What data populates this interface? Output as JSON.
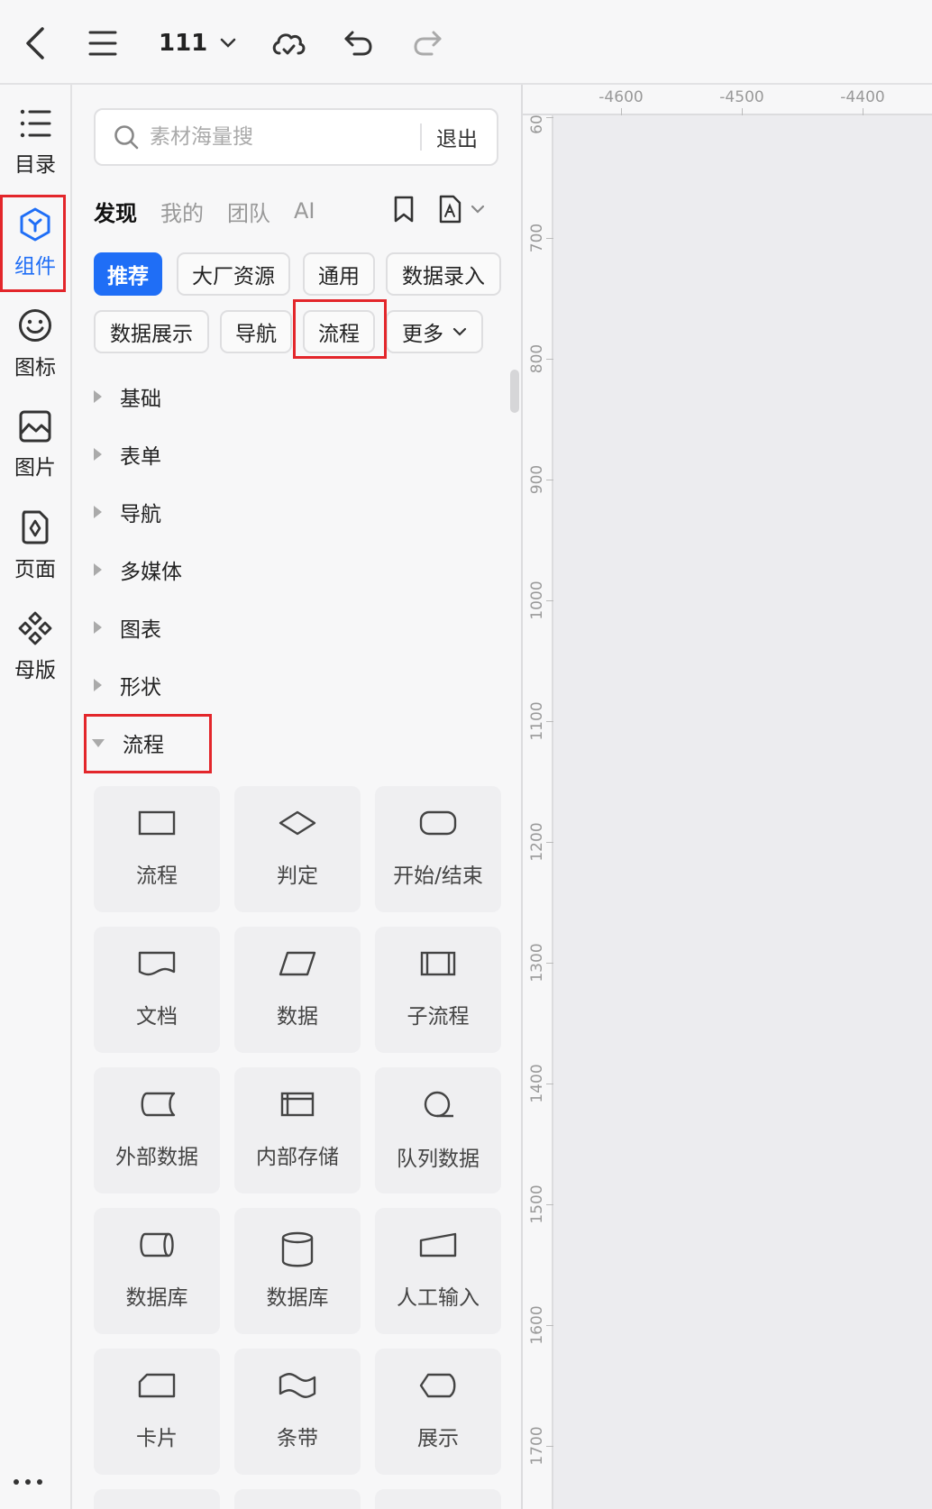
{
  "toolbar": {
    "back_icon": "chevron-left-icon",
    "menu_icon": "hamburger-menu-icon",
    "doc_title": "111",
    "cloud_icon": "cloud-sync-icon",
    "undo_icon": "undo-icon",
    "redo_icon": "redo-icon"
  },
  "rail": {
    "items": [
      {
        "label": "目录",
        "icon": "list-icon",
        "active": false
      },
      {
        "label": "组件",
        "icon": "component-cube-icon",
        "active": true
      },
      {
        "label": "图标",
        "icon": "smiley-icon",
        "active": false
      },
      {
        "label": "图片",
        "icon": "image-icon",
        "active": false
      },
      {
        "label": "页面",
        "icon": "page-icon",
        "active": false
      },
      {
        "label": "母版",
        "icon": "master-diamonds-icon",
        "active": false
      }
    ],
    "more_icon": "more-dots-icon"
  },
  "panel": {
    "search": {
      "placeholder": "素材海量搜",
      "exit_label": "退出"
    },
    "tabs": [
      {
        "label": "发现",
        "active": true
      },
      {
        "label": "我的",
        "active": false
      },
      {
        "label": "团队",
        "active": false
      },
      {
        "label": "AI",
        "active": false
      }
    ],
    "chips": [
      {
        "label": "推荐",
        "active": true
      },
      {
        "label": "大厂资源",
        "active": false
      },
      {
        "label": "通用",
        "active": false
      },
      {
        "label": "数据录入",
        "active": false
      },
      {
        "label": "数据展示",
        "active": false
      },
      {
        "label": "导航",
        "active": false
      },
      {
        "label": "流程",
        "active": false
      },
      {
        "label": "更多",
        "active": false
      }
    ],
    "categories": [
      {
        "label": "基础",
        "expanded": false
      },
      {
        "label": "表单",
        "expanded": false
      },
      {
        "label": "导航",
        "expanded": false
      },
      {
        "label": "多媒体",
        "expanded": false
      },
      {
        "label": "图表",
        "expanded": false
      },
      {
        "label": "形状",
        "expanded": false
      },
      {
        "label": "流程",
        "expanded": true
      }
    ],
    "flow_items": [
      {
        "label": "流程",
        "icon": "process-rect-icon"
      },
      {
        "label": "判定",
        "icon": "decision-diamond-icon"
      },
      {
        "label": "开始/结束",
        "icon": "terminator-pill-icon"
      },
      {
        "label": "文档",
        "icon": "document-wave-icon"
      },
      {
        "label": "数据",
        "icon": "data-parallelogram-icon"
      },
      {
        "label": "子流程",
        "icon": "subprocess-icon"
      },
      {
        "label": "外部数据",
        "icon": "external-data-icon"
      },
      {
        "label": "内部存储",
        "icon": "internal-storage-icon"
      },
      {
        "label": "队列数据",
        "icon": "queue-data-icon"
      },
      {
        "label": "数据库",
        "icon": "database-horizontal-icon"
      },
      {
        "label": "数据库",
        "icon": "database-cylinder-icon"
      },
      {
        "label": "人工输入",
        "icon": "manual-input-icon"
      },
      {
        "label": "卡片",
        "icon": "card-icon"
      },
      {
        "label": "条带",
        "icon": "tape-icon"
      },
      {
        "label": "展示",
        "icon": "display-icon"
      }
    ]
  },
  "ruler": {
    "top": [
      "-4600",
      "-4500",
      "-4400"
    ],
    "left": [
      "60",
      "700",
      "800",
      "900",
      "1000",
      "1100",
      "1200",
      "1300",
      "1400",
      "1500",
      "1600",
      "1700"
    ]
  },
  "colors": {
    "accent": "#1f6ef6",
    "highlight": "#e3262b"
  }
}
